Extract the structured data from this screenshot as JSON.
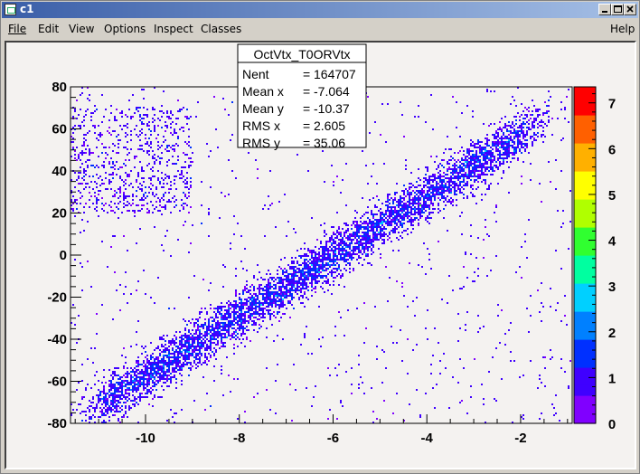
{
  "window": {
    "title": "c1",
    "buttons": [
      "minimize",
      "maximize",
      "close"
    ]
  },
  "menu": {
    "file": "File",
    "edit": "Edit",
    "view": "View",
    "options": "Options",
    "inspect": "Inspect",
    "classes": "Classes",
    "help": "Help"
  },
  "stats_box": {
    "name": "OctVtx_T0ORVtx",
    "rows": [
      {
        "label": "Nent",
        "value": "164707"
      },
      {
        "label": "Mean x",
        "value": "-7.064"
      },
      {
        "label": "Mean y",
        "value": "-10.37"
      },
      {
        "label": "RMS x ",
        "value": "2.605"
      },
      {
        "label": "RMS y ",
        "value": "35.06"
      }
    ]
  },
  "chart_data": {
    "type": "heatmap",
    "title": "",
    "xlabel": "",
    "ylabel": "",
    "xlim": [
      -11.6,
      -0.9
    ],
    "ylim": [
      -80,
      80
    ],
    "x_ticks": [
      "-10",
      "-8",
      "-6",
      "-4",
      "-2"
    ],
    "x_tick_values": [
      -10,
      -8,
      -6,
      -4,
      -2
    ],
    "y_ticks": [
      "-80",
      "-60",
      "-40",
      "-20",
      "0",
      "20",
      "40",
      "60",
      "80"
    ],
    "y_tick_values": [
      -80,
      -60,
      -40,
      -20,
      0,
      20,
      40,
      60,
      80
    ],
    "z_ticks": [
      "0",
      "1",
      "2",
      "3",
      "4",
      "5",
      "6",
      "7"
    ],
    "z_tick_values": [
      0,
      1,
      2,
      3,
      4,
      5,
      6,
      7
    ],
    "zlim": [
      0,
      7.35
    ],
    "band": {
      "x_start": -11.0,
      "y_start": -72,
      "x_end": -1.8,
      "y_end": 60
    },
    "entries": 164707,
    "mean_x": -7.064,
    "mean_y": -10.37,
    "rms_x": 2.605,
    "rms_y": 35.06,
    "grid": false,
    "palette": [
      "#8000ff",
      "#3f00ff",
      "#0030ff",
      "#0080ff",
      "#00d0ff",
      "#00ffa0",
      "#30ff30",
      "#b0ff00",
      "#ffff00",
      "#ffb000",
      "#ff6000",
      "#ff0000"
    ]
  },
  "colors": {
    "canvas_bg": "#f4f2f0",
    "titlebar_left": "#3a5ea8",
    "titlebar_right": "#a6c0e6",
    "frame_border": "#c8c800"
  }
}
